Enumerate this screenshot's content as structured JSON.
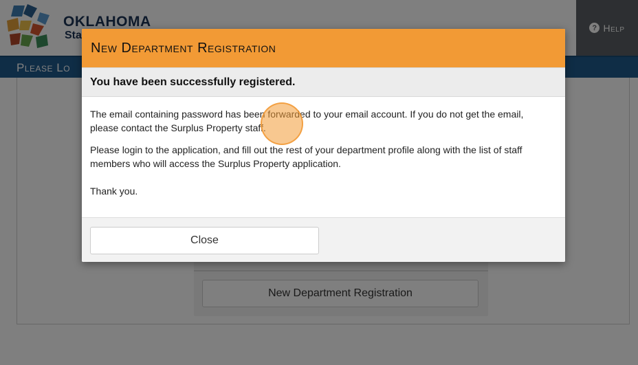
{
  "header": {
    "logo_title": "OKLAHOMA",
    "logo_sub": "Sta",
    "help_label": "Help",
    "help_icon": "question-circle-icon"
  },
  "bluebar": {
    "title": "Please Lo"
  },
  "background": {
    "register_button": "New Department Registration"
  },
  "modal": {
    "title": "New Department Registration",
    "subtitle": "You have been successfully registered.",
    "paragraphs": [
      "The email containing password has been forwarded to your email account. If you do not get the email, please contact the Surplus Property staff.",
      "Please login to the application, and fill out the rest of your department profile along with the list of staff members who will access the Surplus Property application.",
      "Thank you."
    ],
    "close_label": "Close"
  },
  "colors": {
    "accent_orange": "#f29a35",
    "brand_blue": "#1f5a8c",
    "help_gray": "#5a5f64"
  }
}
